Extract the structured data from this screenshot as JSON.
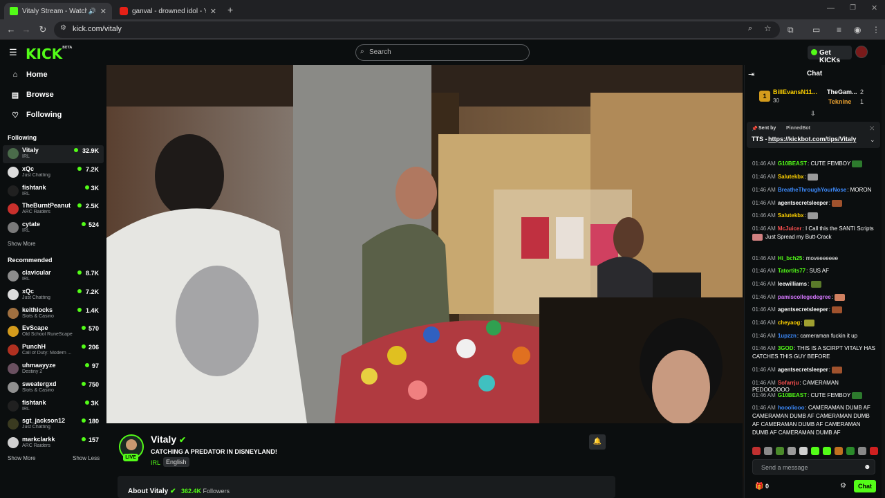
{
  "browser": {
    "tabs": [
      {
        "title": "Vitaly Stream - Watch Live o",
        "active": true
      },
      {
        "title": "ganval - drowned idol - YouTu",
        "active": false
      }
    ],
    "url": "kick.com/vitaly"
  },
  "kick": {
    "logo": "KICK",
    "logo_badge": "BETA",
    "search_placeholder": "Search",
    "get_kicks": "Get KICKs"
  },
  "sidebar": {
    "nav": [
      {
        "label": "Home",
        "icon": "home-icon"
      },
      {
        "label": "Browse",
        "icon": "browse-icon"
      },
      {
        "label": "Following",
        "icon": "heart-icon"
      }
    ],
    "following_header": "Following",
    "following": [
      {
        "name": "Vitaly",
        "category": "IRL",
        "viewers": "32.9K",
        "color": "#4a6b4a"
      },
      {
        "name": "xQc",
        "category": "Just Chatting",
        "viewers": "7.2K",
        "color": "#dcdcdc"
      },
      {
        "name": "fishtank",
        "category": "IRL",
        "viewers": "3K",
        "color": "#202020"
      },
      {
        "name": "TheBurntPeanut",
        "category": "ARC Raiders",
        "viewers": "2.5K",
        "color": "#c9302c"
      },
      {
        "name": "cytate",
        "category": "IRL",
        "viewers": "524",
        "color": "#7a7a7a"
      }
    ],
    "show_more": "Show More",
    "recommended_header": "Recommended",
    "recommended": [
      {
        "name": "clavicular",
        "category": "IRL",
        "viewers": "8.7K",
        "color": "#8c8c8c"
      },
      {
        "name": "xQc",
        "category": "Just Chatting",
        "viewers": "7.2K",
        "color": "#dcdcdc"
      },
      {
        "name": "keithlocks",
        "category": "Slots & Casino",
        "viewers": "1.4K",
        "color": "#a07040"
      },
      {
        "name": "EvScape",
        "category": "Old School RuneScape",
        "viewers": "570",
        "color": "#d49b1c"
      },
      {
        "name": "PunchH",
        "category": "Call of Duty: Modern ...",
        "viewers": "206",
        "color": "#b03020"
      },
      {
        "name": "uhmaayyze",
        "category": "Destiny 2",
        "viewers": "97",
        "color": "#6a5060"
      },
      {
        "name": "sweatergxd",
        "category": "Slots & Casino",
        "viewers": "750",
        "color": "#909090"
      },
      {
        "name": "fishtank",
        "category": "IRL",
        "viewers": "3K",
        "color": "#202020"
      },
      {
        "name": "sgt_jackson12",
        "category": "Just Chatting",
        "viewers": "180",
        "color": "#3a3a20"
      },
      {
        "name": "markclarkk",
        "category": "ARC Raiders",
        "viewers": "157",
        "color": "#d0d0d0"
      }
    ],
    "show_more_2": "Show More",
    "show_less": "Show Less"
  },
  "stream": {
    "name": "Vitaly",
    "title": "CATCHING A PREDATOR IN DISNEYLAND!",
    "category": "IRL",
    "language": "English",
    "live": "LIVE",
    "about_label": "About Vitaly",
    "followers_count": "362.4K",
    "followers_label": "Followers"
  },
  "chat": {
    "header": "Chat",
    "leaderboard": [
      {
        "name": "BillEvansN11...",
        "value": "30",
        "rank": "1"
      },
      {
        "name": "TheGam...",
        "value": "2"
      },
      {
        "name": "Teknine",
        "value": "1"
      }
    ],
    "pinned": {
      "sent_by": "Sent by",
      "bot": "PinnedBot",
      "prefix": "TTS - ",
      "link": "https://kickbot.com/tips/Vitaly"
    },
    "messages": [
      {
        "time": "01:46 AM",
        "user": "G10BEAST",
        "color": "#53fc18",
        "text": ": CUTE FEMBOY",
        "emote": "#2d7a2d"
      },
      {
        "time": "01:46 AM",
        "user": "Salutekbx",
        "color": "#ffd200",
        "text": ":",
        "emote": "#9a9a9a"
      },
      {
        "time": "01:46 AM",
        "user": "BreatheThroughYourNose",
        "color": "#3d8bfd",
        "text": ": MORON",
        "emote": ""
      },
      {
        "time": "01:46 AM",
        "user": "agentsecretsleeper",
        "color": "#ffffff",
        "text": ":",
        "emote": "#a0522d"
      },
      {
        "time": "01:46 AM",
        "user": "Salutekbx",
        "color": "#ffd200",
        "text": ":",
        "emote": "#9a9a9a"
      },
      {
        "time": "01:46 AM",
        "user": "McJuicer",
        "color": "#ff5050",
        "text": ": I Call this the SANTI Scripts",
        "emote": ""
      },
      {
        "time": "",
        "user": "",
        "color": "#ffffff",
        "text": "Just Spread my Butt-Crack",
        "emote": ""
      },
      {
        "time": "01:46 AM",
        "user": "Hi_bch25",
        "color": "#53fc18",
        "text": ": moveeeeeee",
        "emote": ""
      },
      {
        "time": "01:46 AM",
        "user": "Tatortits77",
        "color": "#53fc18",
        "text": ": SUS AF",
        "emote": ""
      },
      {
        "time": "01:46 AM",
        "user": "leewilliams",
        "color": "#ffffff",
        "text": ":",
        "emote": "#5a7a2a"
      },
      {
        "time": "01:46 AM",
        "user": "pamiscollegedegree",
        "color": "#d678ff",
        "text": ":",
        "emote": "#d08060"
      },
      {
        "time": "01:46 AM",
        "user": "agentsecretsleeper",
        "color": "#ffffff",
        "text": ":",
        "emote": "#a0522d"
      },
      {
        "time": "01:46 AM",
        "user": "cheyaog",
        "color": "#ffd200",
        "text": ":",
        "emote": "#a0a030"
      },
      {
        "time": "01:46 AM",
        "user": "1upzzn",
        "color": "#3d8bfd",
        "text": ": cameraman fuckin it up",
        "emote": ""
      },
      {
        "time": "01:46 AM",
        "user": "3GOD",
        "color": "#53fc18",
        "text": ": THIS IS A SCIRPT VITALY HAS",
        "emote": ""
      },
      {
        "time": "",
        "user": "",
        "color": "#ffffff",
        "text": "CATCHES THIS GUY BEFORE",
        "emote": ""
      },
      {
        "time": "01:46 AM",
        "user": "agentsecretsleeper",
        "color": "#ffffff",
        "text": ":",
        "emote": "#a0522d"
      },
      {
        "time": "01:46 AM",
        "user": "Sofarrju",
        "color": "#ff5050",
        "text": ": CAMERAMAN PEDOOOOOO",
        "emote": ""
      },
      {
        "time": "01:46 AM",
        "user": "G10BEAST",
        "color": "#53fc18",
        "text": ": CUTE FEMBOY",
        "emote": "#2d7a2d"
      },
      {
        "time": "01:46 AM",
        "user": "hoooliooo",
        "color": "#3d8bfd",
        "text": ": CAMERAMAN DUMB AF",
        "emote": ""
      },
      {
        "time": "",
        "user": "",
        "color": "#ffffff",
        "text": "CAMERAMAN DUMB AF CAMERAMAN DUMB",
        "emote": ""
      },
      {
        "time": "",
        "user": "",
        "color": "#ffffff",
        "text": "AF CAMERAMAN DUMB AF CAMERAMAN",
        "emote": ""
      },
      {
        "time": "",
        "user": "",
        "color": "#ffffff",
        "text": "DUMB AF CAMERAMAN DUMB AF",
        "emote": ""
      }
    ],
    "input_placeholder": "Send a message",
    "points": "0",
    "send_label": "Chat"
  }
}
